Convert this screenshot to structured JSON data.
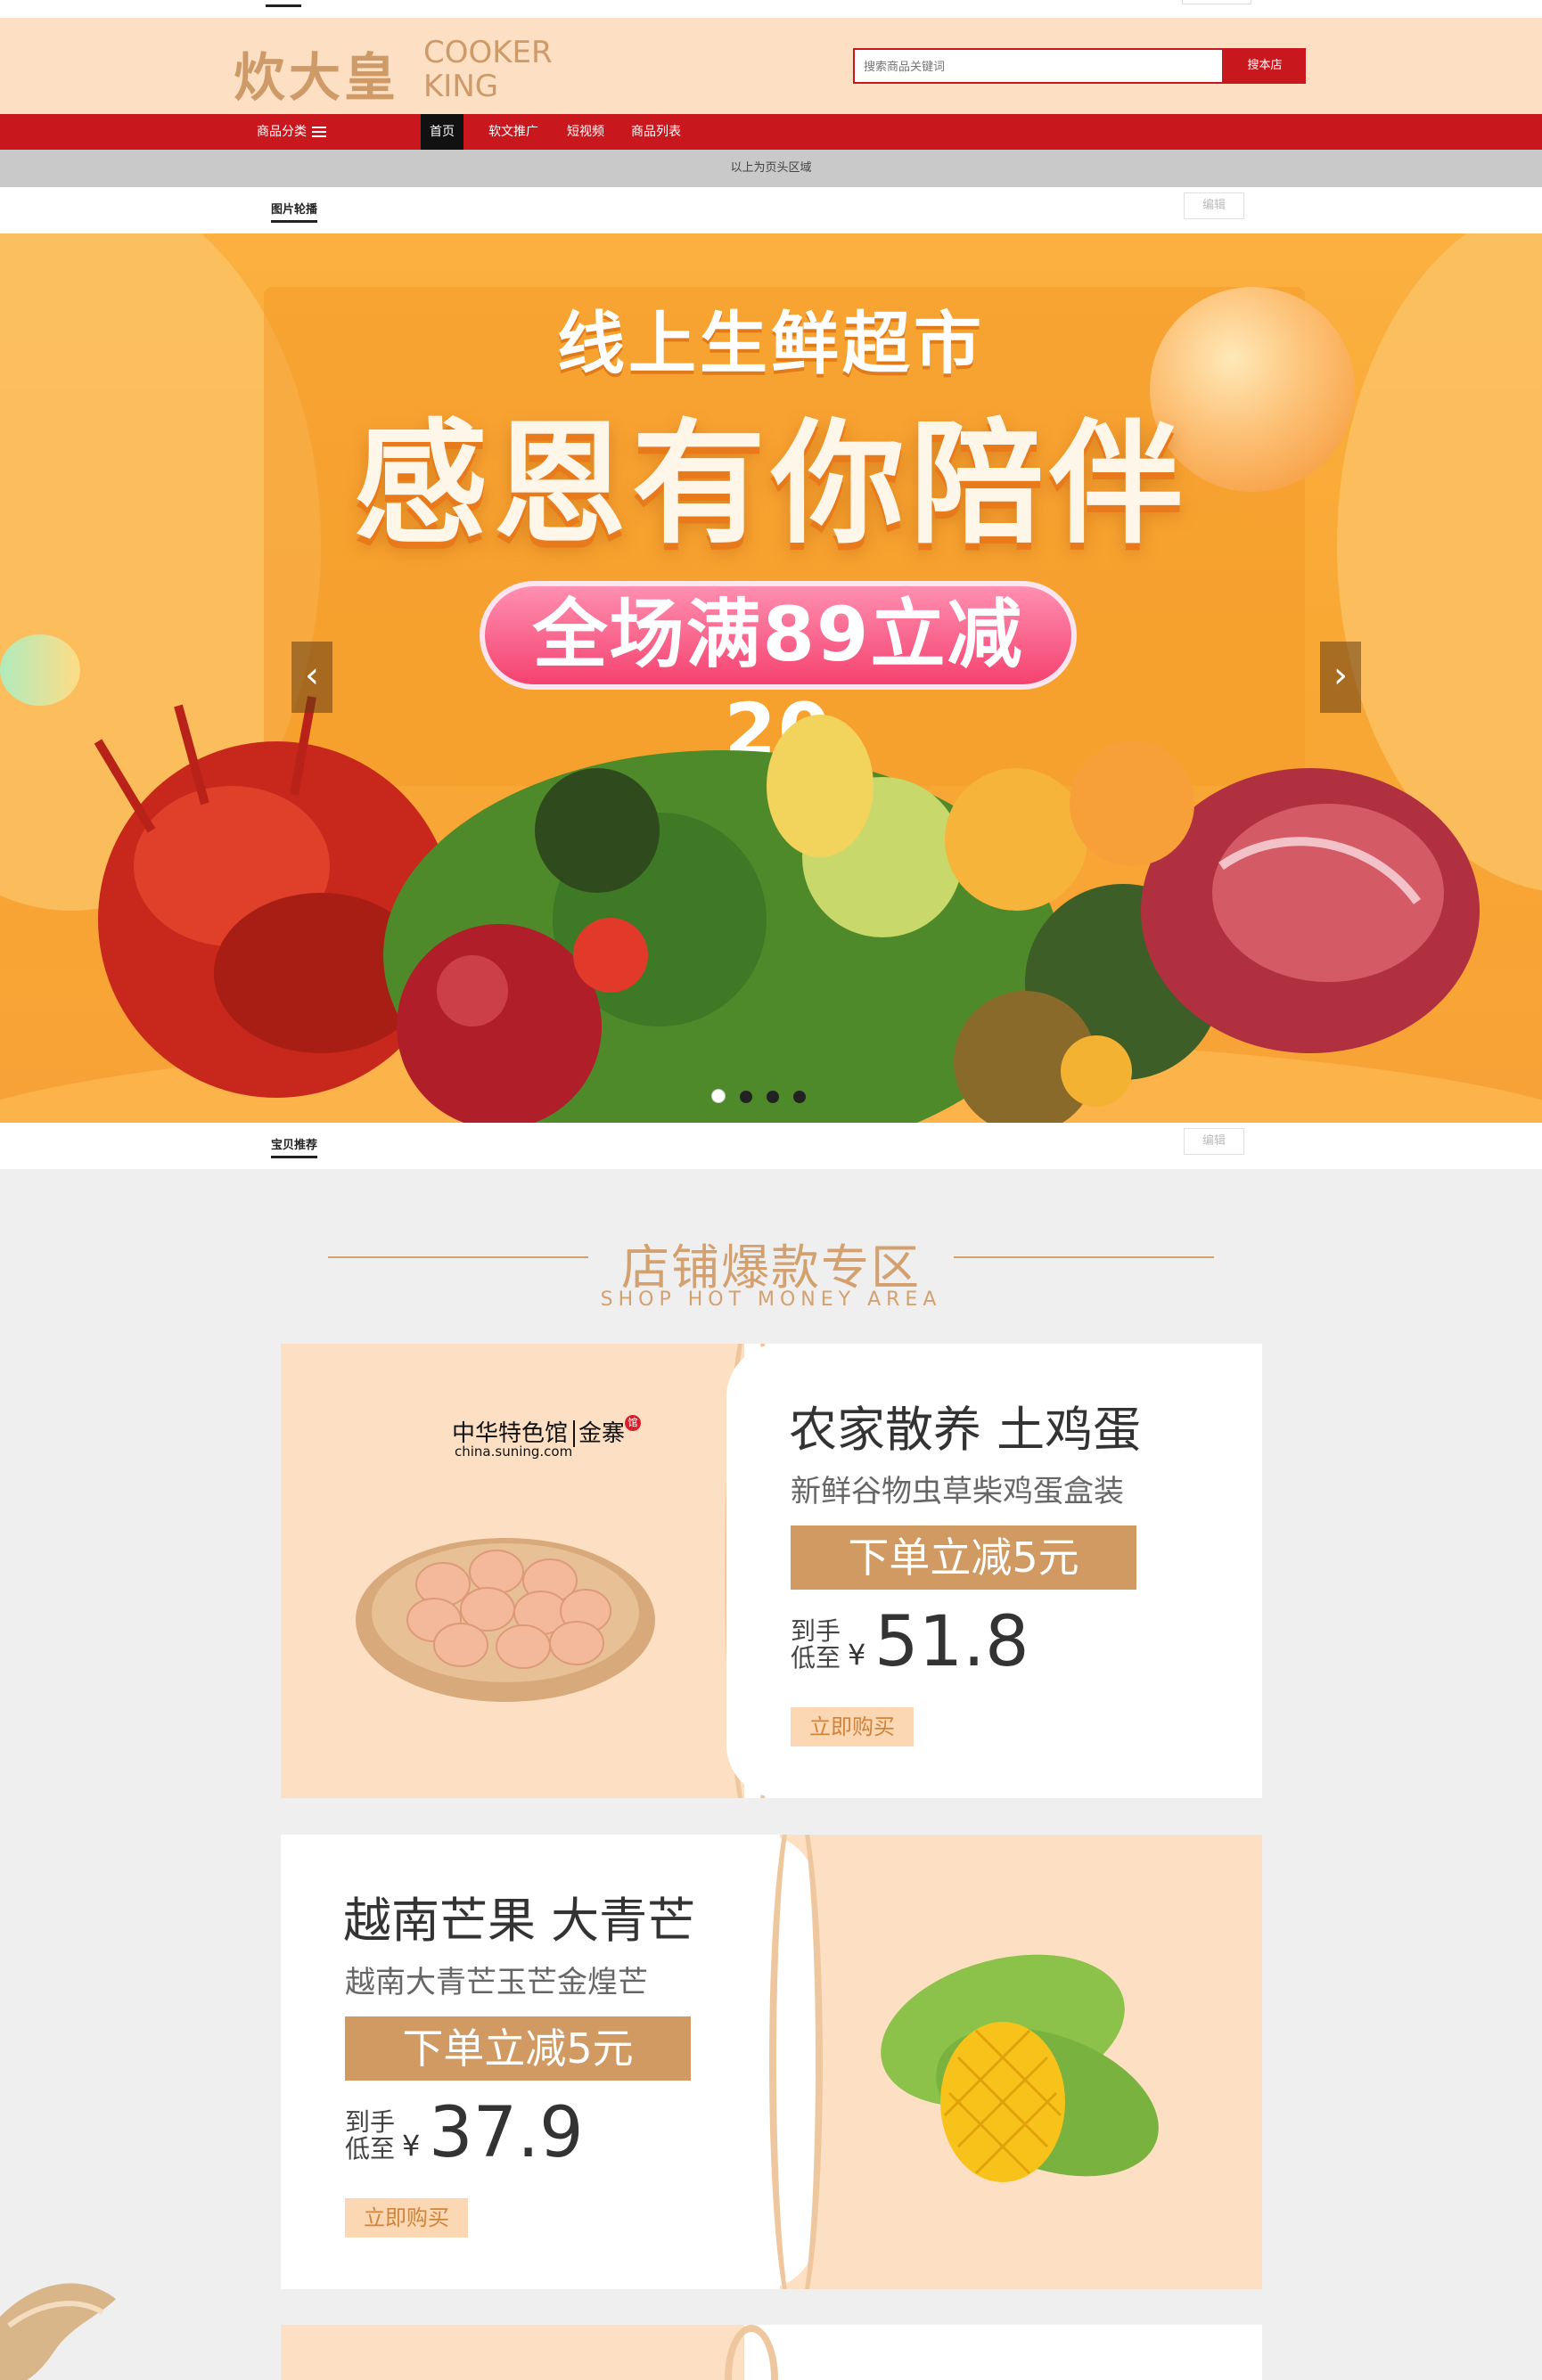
{
  "header": {
    "logo_cn": "炊大皇",
    "logo_en_line1": "COOKER",
    "logo_en_line2": "KING",
    "search_placeholder": "搜索商品关键词",
    "search_button": "搜本店"
  },
  "nav": {
    "category": "商品分类",
    "items": [
      "首页",
      "软文推广",
      "短视频",
      "商品列表"
    ],
    "active_index": 0
  },
  "notice": "以上为页头区域",
  "modules": {
    "carousel_title": "图片轮播",
    "recommend_title": "宝贝推荐",
    "edit_label": "编辑"
  },
  "banner": {
    "subtitle": "线上生鲜超市",
    "title": "感恩有你陪伴",
    "promo": "全场满89立减20",
    "slide_count": 4,
    "active_slide": 1
  },
  "section": {
    "title": "店铺爆款专区",
    "subtitle": "SHOP HOT MONEY AREA"
  },
  "products": [
    {
      "brand_cn": "中华特色馆",
      "brand_shop": "金寨",
      "brand_badge": "馆",
      "brand_url": "china.suning.com",
      "title": "农家散养 土鸡蛋",
      "subtitle": "新鲜谷物虫草柴鸡蛋盒装",
      "promo": "下单立减5元",
      "price_label_1": "到手",
      "price_label_2": "低至",
      "currency": "¥",
      "price": "51.8",
      "buy": "立即购买"
    },
    {
      "title": "越南芒果 大青芒",
      "subtitle": "越南大青芒玉芒金煌芒",
      "promo": "下单立减5元",
      "price_label_1": "到手",
      "price_label_2": "低至",
      "currency": "¥",
      "price": "37.9",
      "buy": "立即购买"
    }
  ],
  "colors": {
    "brand_red": "#c9171e",
    "peach": "#fde0c3",
    "gold": "#d09a62",
    "banner_orange": "#f9a834",
    "pill_pink": "#f5426f"
  }
}
